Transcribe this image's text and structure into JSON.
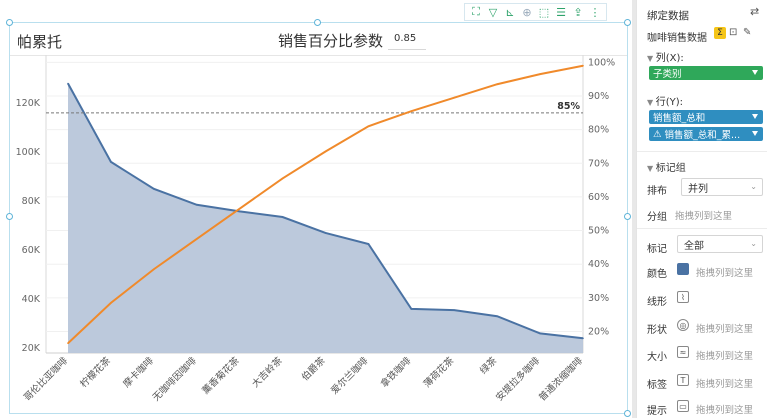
{
  "widget": {
    "title": "帕累托",
    "param_label": "销售百分比参数",
    "param_value": "0.85"
  },
  "toolbar": {
    "icons": [
      "expand-icon",
      "filter-icon",
      "drill-icon",
      "zoom-icon",
      "select-icon",
      "list-icon",
      "export-icon",
      "more-icon"
    ]
  },
  "panel": {
    "title": "绑定数据",
    "dataset": "咖啡销售数据",
    "columns_label": "列(X):",
    "column_field": "子类别",
    "rows_label": "行(Y):",
    "row_field_1": "销售额_总和",
    "row_field_2": "销售额_总和_累...",
    "marker_group": "标记组",
    "layout_label": "排布",
    "layout_value": "并列",
    "group_label": "分组",
    "drop_hint": "拖拽列到这里",
    "mark_label": "标记",
    "mark_value": "全部",
    "props": {
      "color": "颜色",
      "line": "线形",
      "shape": "形状",
      "size": "大小",
      "label": "标签",
      "tooltip": "提示"
    },
    "colors": {
      "column_pill": "#2fa85a",
      "row_pill": "#2f8ec0"
    }
  },
  "chart_data": {
    "type": "area+line",
    "categories": [
      "哥伦比亚咖啡",
      "柠檬花茶",
      "摩卡咖啡",
      "无咖啡因咖啡",
      "薰香菊花茶",
      "大吉岭茶",
      "伯爵茶",
      "爱尔兰咖啡",
      "拿铁咖啡",
      "薄荷花茶",
      "绿茶",
      "安提拉多咖啡",
      "普通浓缩咖啡"
    ],
    "series": [
      {
        "name": "",
        "axis": "left",
        "kind": "area",
        "color": "#4a72a3",
        "fill": "#b8c6da",
        "values": [
          128000,
          96000,
          85000,
          78500,
          75800,
          73500,
          67000,
          62500,
          36000,
          35500,
          33000,
          26000,
          24000
        ]
      },
      {
        "name": "",
        "axis": "right",
        "kind": "line",
        "color": "#f08a2b",
        "values": [
          16.5,
          28.5,
          38.5,
          47.5,
          56.5,
          65.5,
          73.5,
          81,
          85.5,
          89.5,
          93.5,
          96.5,
          99
        ]
      }
    ],
    "y_left": {
      "min": 18000,
      "max": 138000,
      "ticks": [
        20000,
        40000,
        60000,
        80000,
        100000,
        120000
      ],
      "tick_labels": [
        "20K",
        "40K",
        "60K",
        "80K",
        "100K",
        "120K"
      ]
    },
    "y_right": {
      "min": 13.6,
      "max": 101,
      "ticks": [
        20,
        30,
        40,
        50,
        60,
        70,
        80,
        90,
        100
      ],
      "tick_labels": [
        "20%",
        "30%",
        "40%",
        "50%",
        "60%",
        "70%",
        "80%",
        "90%",
        "100%"
      ]
    },
    "reference_line": {
      "axis": "right",
      "value": 85,
      "label": "85%"
    },
    "grid": true
  }
}
